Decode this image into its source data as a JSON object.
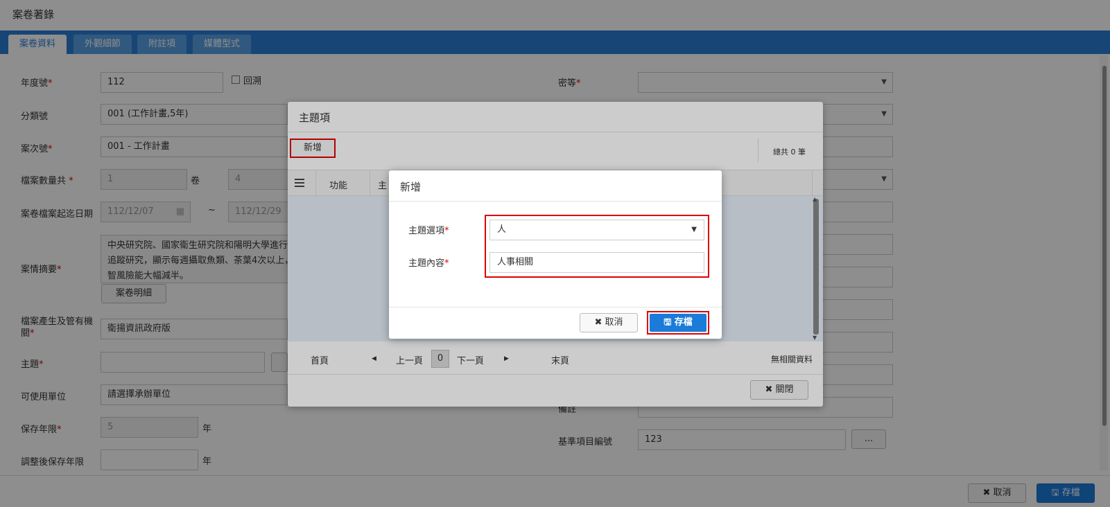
{
  "page": {
    "title": "案卷著錄"
  },
  "tabs": [
    {
      "label": "案卷資料"
    },
    {
      "label": "外觀細節"
    },
    {
      "label": "附註項"
    },
    {
      "label": "媒體型式"
    }
  ],
  "form": {
    "year_label": "年度號",
    "year_value": "112",
    "retro_label": "回溯",
    "class_label": "分類號",
    "class_value": "001 (工作計畫,5年)",
    "case_label": "案次號",
    "case_value": "001 - 工作計畫",
    "count_label": "檔案數量共",
    "count_value": "1",
    "count_unit": "卷",
    "count_value2": "4",
    "date_label": "案卷檔案起迄日期",
    "date_from": "112/12/07",
    "date_sep": "~",
    "date_to": "112/12/29",
    "summary_label": "案情摘要",
    "summary_text": "中央研究院、國家衛生研究院和陽明大學進行的追蹤研究，顯示每週攝取魚類、茶葉4次以上，智風險能大幅減半。",
    "summary_btn": "案卷明細",
    "agency_label": "檔案產生及管有機關",
    "agency_value": "衛揚資訊政府版",
    "theme_label": "主題",
    "unit_label": "可使用單位",
    "unit_value": "請選擇承辦單位",
    "keep_label": "保存年限",
    "keep_value": "5",
    "keep_unit": "年",
    "keep_adj_label": "調整後保存年限",
    "keep_adj_unit": "年",
    "secret_label": "密等",
    "remark_label": "備註",
    "std_label": "基準項目編號",
    "std_value": "123",
    "std_btn": "..."
  },
  "footer": {
    "cancel": "✖ 取消",
    "save": "🖫 存檔"
  },
  "theme_dialog": {
    "title": "主題項",
    "add_btn": "新增",
    "total": "總共 0 筆",
    "col_func": "功能",
    "col_theme": "主",
    "pager": {
      "first": "首頁",
      "prev": "上一頁",
      "page": "0",
      "next": "下一頁",
      "last": "末頁",
      "empty": "無相關資料"
    },
    "close_btn": "✖ 關閉"
  },
  "add_dialog": {
    "title": "新增",
    "option_label": "主題選項",
    "option_value": "人",
    "content_label": "主題內容",
    "content_value": "人事相關",
    "cancel": "✖ 取消",
    "save": "🖫 存檔"
  }
}
